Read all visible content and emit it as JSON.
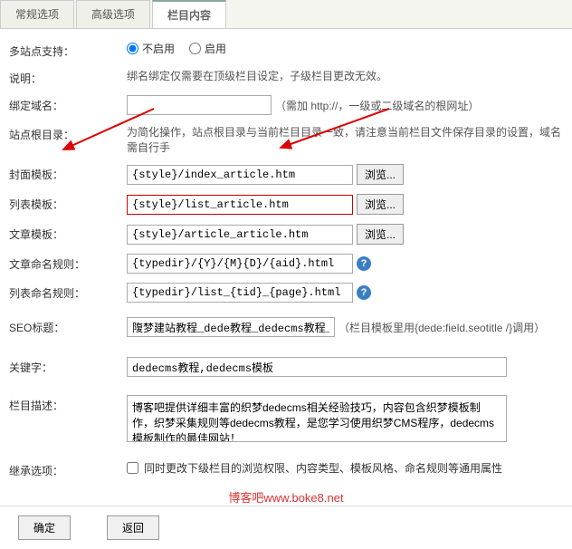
{
  "tabs": {
    "general": "常规选项",
    "advanced": "高级选项",
    "column": "栏目内容"
  },
  "labels": {
    "multisite": "多站点支持：",
    "desc": "说明：",
    "binddomain": "绑定域名：",
    "siteroot": "站点根目录：",
    "covertpl": "封面模板：",
    "listtpl": "列表模板：",
    "articletpl": "文章模板：",
    "articlerule": "文章命名规则：",
    "listrule": "列表命名规则：",
    "seotitle": "SEO标题：",
    "keywords": "关键字：",
    "columndesc": "栏目描述：",
    "inherit": "继承选项："
  },
  "radios": {
    "off": "不启用",
    "on": "启用"
  },
  "desc_text": "绑名绑定仅需要在顶级栏目设定，子级栏目更改无效。",
  "binddomain_hint": "（需加 http://，一级或二级域名的根网址）",
  "siteroot_hint": "为简化操作，站点根目录与当前栏目目录一致，请注意当前栏目文件保存目录的设置，域名需自行手",
  "inputs": {
    "covertpl": "{style}/index_article.htm",
    "listtpl": "{style}/list_article.htm",
    "articletpl": "{style}/article_article.htm",
    "articlerule": "{typedir}/{Y}/{M}{D}/{aid}.html",
    "listrule": "{typedir}/list_{tid}_{page}.html",
    "seotitle": "䧗梦建站教程_dede教程_dedecms教程_织梦教程",
    "keywords": "dedecms教程,dedecms模板",
    "columndesc": "博客吧提供详细丰富的织梦dedecms相关经验技巧，内容包含织梦模板制作，织梦采集规则等dedecms教程，是您学习使用织梦CMS程序，dedecms模板制作的最佳网站！"
  },
  "seo_note": "（栏目模板里用{dede:field.seotitle /}调用）",
  "inherit_text": "同时更改下级栏目的浏览权限、内容类型、模板风格、命名规则等通用属性",
  "buttons": {
    "browse": "浏览...",
    "ok": "确定",
    "back": "返回"
  },
  "watermark": "博客吧www.boke8.net"
}
